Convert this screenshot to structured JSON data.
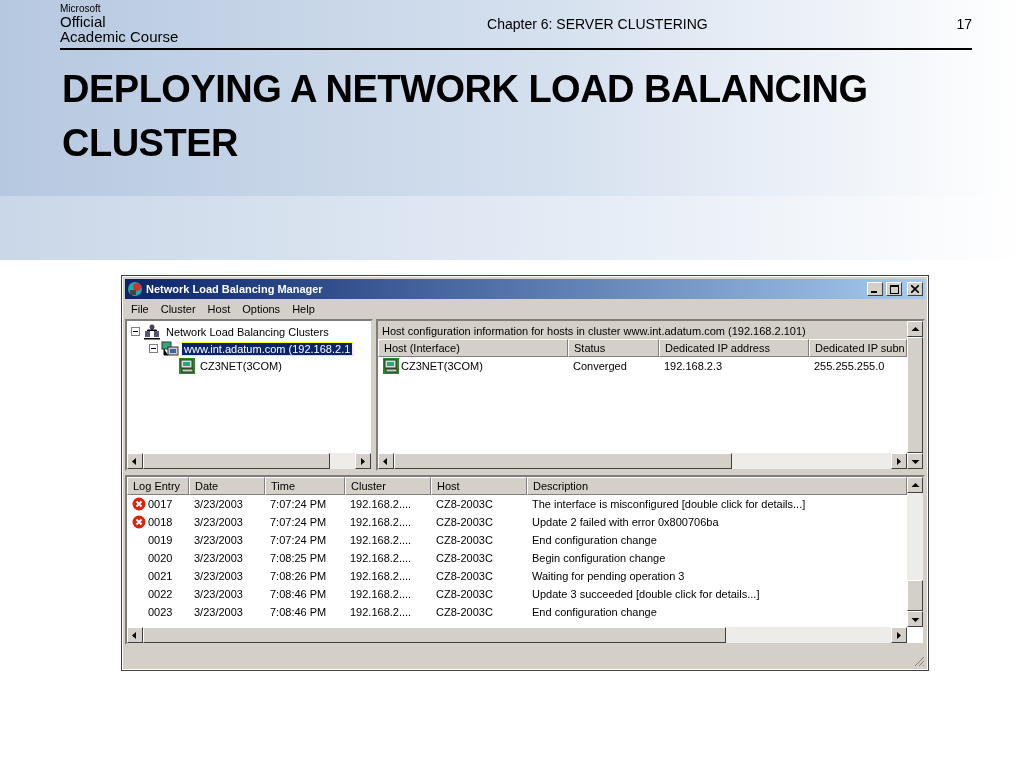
{
  "slide": {
    "logo": {
      "brand": "Microsoft",
      "lines": [
        "Official",
        "Academic Course"
      ]
    },
    "chapter": "Chapter 6: SERVER CLUSTERING",
    "page": "17",
    "title": "DEPLOYING A NETWORK LOAD BALANCING CLUSTER"
  },
  "window": {
    "title": "Network Load Balancing Manager",
    "menu": [
      {
        "label": "File"
      },
      {
        "label": "Cluster"
      },
      {
        "label": "Host"
      },
      {
        "label": "Options"
      },
      {
        "label": "Help"
      }
    ],
    "tree": [
      {
        "label": "Network Load Balancing Clusters",
        "kind": "root",
        "expanded": true,
        "selected": false,
        "children": [
          {
            "label": "www.int.adatum.com (192.168.2.1",
            "kind": "cluster",
            "expanded": true,
            "selected": true,
            "children": [
              {
                "label": "CZ3NET(3COM)",
                "kind": "host",
                "selected": false
              }
            ]
          }
        ]
      }
    ],
    "hosts": {
      "caption": "Host configuration information for hosts in cluster www.int.adatum.com (192.168.2.101)",
      "columns": [
        "Host (Interface)",
        "Status",
        "Dedicated IP address",
        "Dedicated IP subn"
      ],
      "rows": [
        [
          "CZ3NET(3COM)",
          "Converged",
          "192.168.2.3",
          "255.255.255.0"
        ]
      ]
    },
    "log": {
      "columns": [
        "Log Entry",
        "Date",
        "Time",
        "Cluster",
        "Host",
        "Description"
      ],
      "rows": [
        {
          "kind": "error",
          "cells": [
            "0017",
            "3/23/2003",
            "7:07:24 PM",
            "192.168.2....",
            "CZ8-2003C",
            "The interface is misconfigured [double click for details...]"
          ]
        },
        {
          "kind": "error",
          "cells": [
            "0018",
            "3/23/2003",
            "7:07:24 PM",
            "192.168.2....",
            "CZ8-2003C",
            "Update 2 failed with error 0x800706ba"
          ]
        },
        {
          "kind": "info",
          "cells": [
            "0019",
            "3/23/2003",
            "7:07:24 PM",
            "192.168.2....",
            "CZ8-2003C",
            "End configuration change"
          ]
        },
        {
          "kind": "info",
          "cells": [
            "0020",
            "3/23/2003",
            "7:08:25 PM",
            "192.168.2....",
            "CZ8-2003C",
            "Begin configuration change"
          ]
        },
        {
          "kind": "info",
          "cells": [
            "0021",
            "3/23/2003",
            "7:08:26 PM",
            "192.168.2....",
            "CZ8-2003C",
            "Waiting for pending operation 3"
          ]
        },
        {
          "kind": "info",
          "cells": [
            "0022",
            "3/23/2003",
            "7:08:46 PM",
            "192.168.2....",
            "CZ8-2003C",
            "Update 3 succeeded [double click for details...]"
          ]
        },
        {
          "kind": "info",
          "cells": [
            "0023",
            "3/23/2003",
            "7:08:46 PM",
            "192.168.2....",
            "CZ8-2003C",
            "End configuration change"
          ]
        }
      ]
    }
  }
}
